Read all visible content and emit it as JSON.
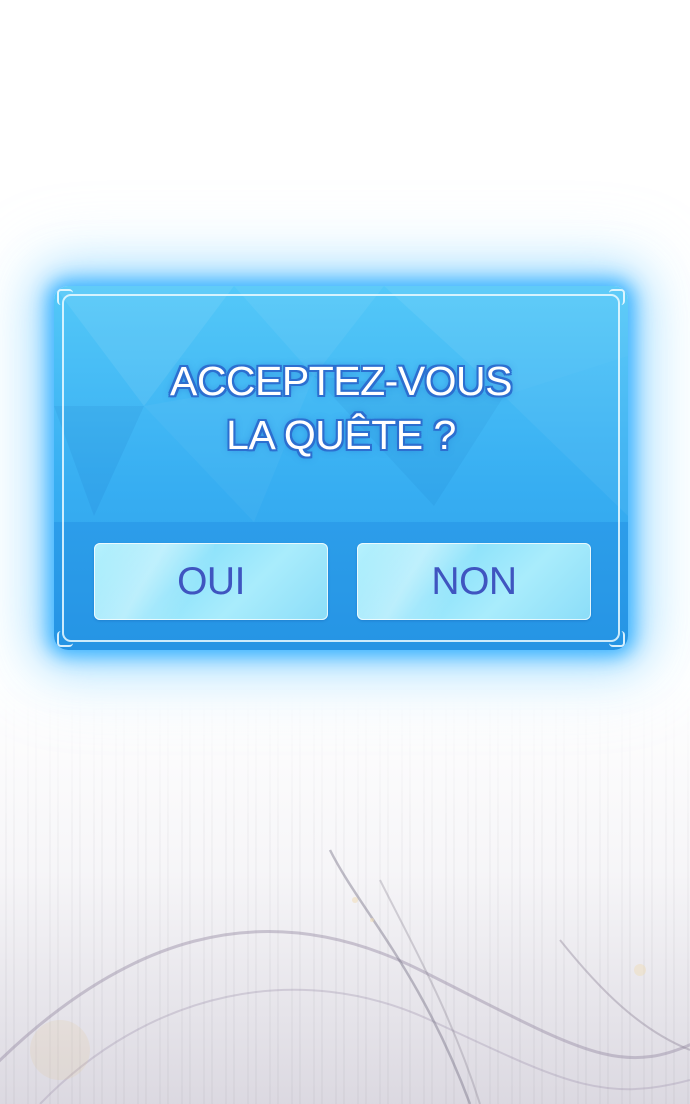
{
  "dialog": {
    "question_line1": "ACCEPTEZ-VOUS",
    "question_line2": "LA QUÊTE ?",
    "yes_label": "OUI",
    "no_label": "NON"
  },
  "colors": {
    "panel": "#37aef2",
    "glow": "#28aaff",
    "button": "#a9ecfc",
    "button_text": "#3f55c0",
    "question_text": "#ffffff",
    "question_outline": "#2c6fd0"
  }
}
